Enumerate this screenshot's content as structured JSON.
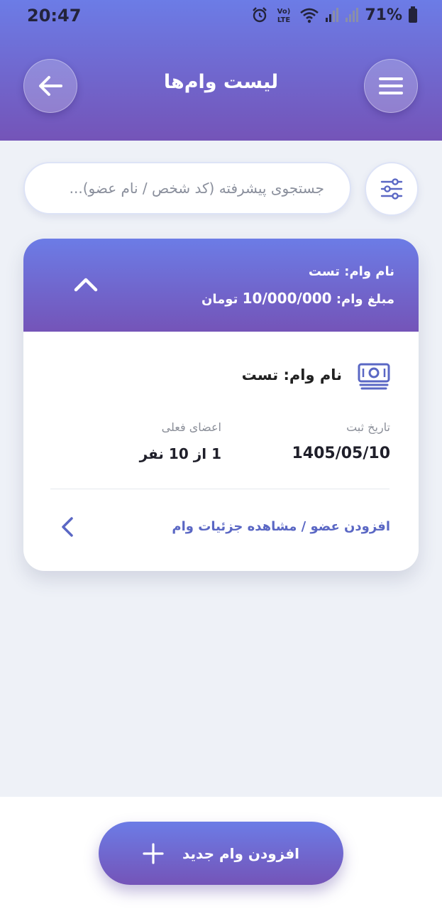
{
  "status_bar": {
    "time": "20:47",
    "battery": "71%",
    "lte_top": "Vo)",
    "lte_bottom": "LTE"
  },
  "header": {
    "title": "لیست وام‌ها"
  },
  "search": {
    "placeholder": "جستجوی پیشرفته (کد شخص / نام عضو)..."
  },
  "loan_card": {
    "header_name_label": "نام وام:",
    "header_name_value": "تست",
    "header_amount_label": "مبلغ وام:",
    "header_amount_value": "10/000/000",
    "header_amount_unit": "تومان",
    "body_title_label": "نام وام:",
    "body_title_value": "تست",
    "date_label": "تاریخ ثبت",
    "date_value": "1405/05/10",
    "members_label": "اعضای فعلی",
    "members_current": "1",
    "members_of": "از",
    "members_total": "10",
    "members_unit": "نفر",
    "detail_link": "افزودن عضو / مشاهده جزئیات وام"
  },
  "bottom": {
    "add_button_label": "افزودن وام جدید"
  },
  "colors": {
    "accent_top": "#6c7ce6",
    "accent_bottom": "#7454b8",
    "link": "#5a67c4"
  }
}
